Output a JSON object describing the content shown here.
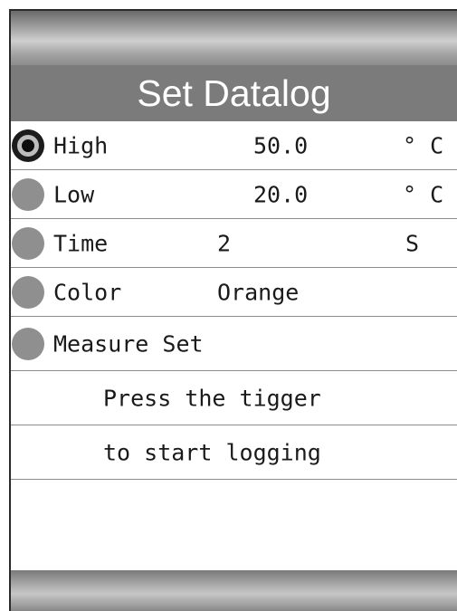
{
  "header": {
    "title": "Set Datalog"
  },
  "menu": {
    "items": [
      {
        "label": "High",
        "value": "50.0",
        "unit": "° C",
        "selected": true
      },
      {
        "label": "Low",
        "value": "20.0",
        "unit": "° C",
        "selected": false
      },
      {
        "label": "Time",
        "value": "2",
        "unit": "S",
        "selected": false
      },
      {
        "label": "Color",
        "value": "Orange",
        "unit": "",
        "selected": false
      },
      {
        "label": "Measure Set",
        "value": "",
        "unit": "",
        "selected": false
      }
    ]
  },
  "message": {
    "line1": "Press the tigger",
    "line2": "to start logging"
  },
  "colors": {
    "title_bar": "#7b7b7b",
    "radio_inactive": "#8f8f8f",
    "radio_active": "#1c1c1c"
  }
}
